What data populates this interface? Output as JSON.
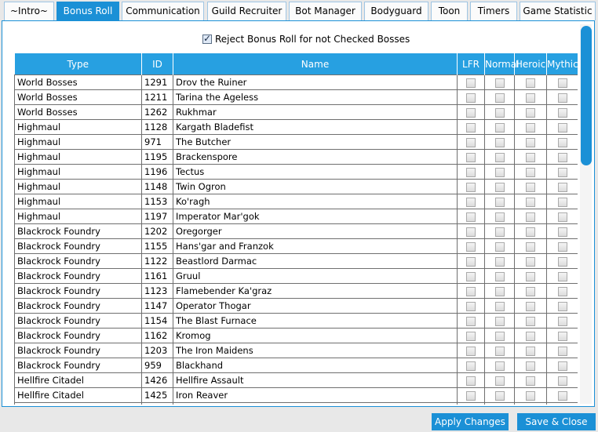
{
  "tabs": [
    "~Intro~",
    "Bonus Roll",
    "Communication",
    "Guild Recruiter",
    "Bot Manager",
    "Bodyguard",
    "Toon",
    "Timers",
    "Game Statistic"
  ],
  "active_tab": "Bonus Roll",
  "reject_option": {
    "label": "Reject Bonus Roll for not Checked Bosses",
    "checked": true
  },
  "table": {
    "headers": {
      "type": "Type",
      "id": "ID",
      "name": "Name",
      "lfr": "LFR",
      "normal": "Normal",
      "heroic": "Heroic",
      "mythic": "Mythic"
    },
    "rows": [
      {
        "type": "World Bosses",
        "id": "1291",
        "name": "Drov the Ruiner"
      },
      {
        "type": "World Bosses",
        "id": "1211",
        "name": "Tarina the Ageless"
      },
      {
        "type": "World Bosses",
        "id": "1262",
        "name": "Rukhmar"
      },
      {
        "type": "Highmaul",
        "id": "1128",
        "name": "Kargath Bladefist"
      },
      {
        "type": "Highmaul",
        "id": "971",
        "name": "The Butcher"
      },
      {
        "type": "Highmaul",
        "id": "1195",
        "name": "Brackenspore"
      },
      {
        "type": "Highmaul",
        "id": "1196",
        "name": "Tectus"
      },
      {
        "type": "Highmaul",
        "id": "1148",
        "name": "Twin Ogron"
      },
      {
        "type": "Highmaul",
        "id": "1153",
        "name": "Ko'ragh"
      },
      {
        "type": "Highmaul",
        "id": "1197",
        "name": "Imperator Mar'gok"
      },
      {
        "type": "Blackrock Foundry",
        "id": "1202",
        "name": "Oregorger"
      },
      {
        "type": "Blackrock Foundry",
        "id": "1155",
        "name": "Hans'gar and Franzok"
      },
      {
        "type": "Blackrock Foundry",
        "id": "1122",
        "name": "Beastlord Darmac"
      },
      {
        "type": "Blackrock Foundry",
        "id": "1161",
        "name": "Gruul"
      },
      {
        "type": "Blackrock Foundry",
        "id": "1123",
        "name": "Flamebender Ka'graz"
      },
      {
        "type": "Blackrock Foundry",
        "id": "1147",
        "name": "Operator Thogar"
      },
      {
        "type": "Blackrock Foundry",
        "id": "1154",
        "name": "The Blast Furnace"
      },
      {
        "type": "Blackrock Foundry",
        "id": "1162",
        "name": "Kromog"
      },
      {
        "type": "Blackrock Foundry",
        "id": "1203",
        "name": "The Iron Maidens"
      },
      {
        "type": "Blackrock Foundry",
        "id": "959",
        "name": "Blackhand"
      },
      {
        "type": "Hellfire Citadel",
        "id": "1426",
        "name": "Hellfire Assault"
      },
      {
        "type": "Hellfire Citadel",
        "id": "1425",
        "name": "Iron Reaver"
      },
      {
        "type": "",
        "id": "",
        "name": ""
      }
    ]
  },
  "buttons": {
    "apply": "Apply Changes",
    "save_close": "Save & Close"
  },
  "colors": {
    "accent": "#1b90d6",
    "header": "#27a0e1"
  }
}
